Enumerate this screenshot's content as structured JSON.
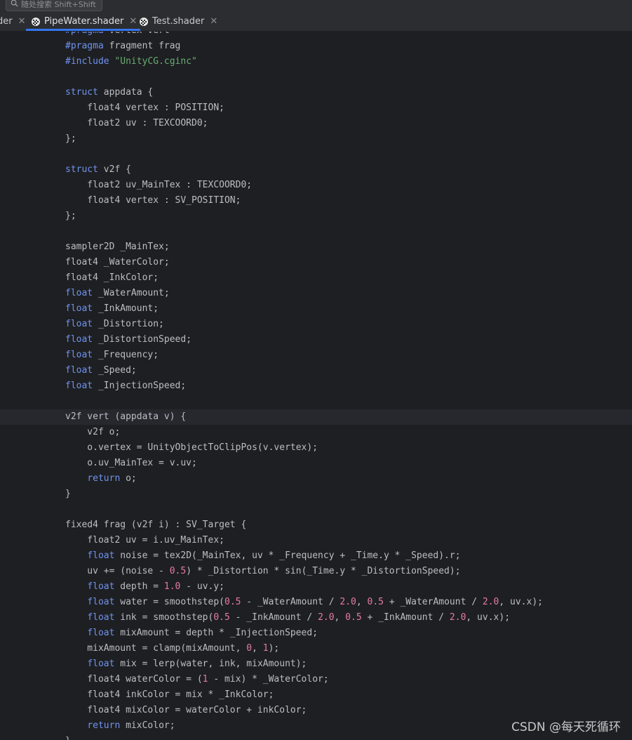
{
  "search": {
    "placeholder": "随处搜索 Shift+Shift"
  },
  "tabs": [
    {
      "label": "der",
      "active": false
    },
    {
      "label": "PipeWater.shader",
      "active": true
    },
    {
      "label": "Test.shader",
      "active": false
    }
  ],
  "code_lines": [
    "#pragma vertex vert",
    "#pragma fragment frag",
    "#include \"UnityCG.cginc\"",
    "",
    "struct appdata {",
    "    float4 vertex : POSITION;",
    "    float2 uv : TEXCOORD0;",
    "};",
    "",
    "struct v2f {",
    "    float2 uv_MainTex : TEXCOORD0;",
    "    float4 vertex : SV_POSITION;",
    "};",
    "",
    "sampler2D _MainTex;",
    "float4 _WaterColor;",
    "float4 _InkColor;",
    "float _WaterAmount;",
    "float _InkAmount;",
    "float _Distortion;",
    "float _DistortionSpeed;",
    "float _Frequency;",
    "float _Speed;",
    "float _InjectionSpeed;",
    "",
    "v2f vert (appdata v) {",
    "    v2f o;",
    "    o.vertex = UnityObjectToClipPos(v.vertex);",
    "    o.uv_MainTex = v.uv;",
    "    return o;",
    "}",
    "",
    "fixed4 frag (v2f i) : SV_Target {",
    "    float2 uv = i.uv_MainTex;",
    "    float noise = tex2D(_MainTex, uv * _Frequency + _Time.y * _Speed).r;",
    "    uv += (noise - 0.5) * _Distortion * sin(_Time.y * _DistortionSpeed);",
    "    float depth = 1.0 - uv.y;",
    "    float water = smoothstep(0.5 - _WaterAmount / 2.0, 0.5 + _WaterAmount / 2.0, uv.x);",
    "    float ink = smoothstep(0.5 - _InkAmount / 2.0, 0.5 + _InkAmount / 2.0, uv.x);",
    "    float mixAmount = depth * _InjectionSpeed;",
    "    mixAmount = clamp(mixAmount, 0, 1);",
    "    float mix = lerp(water, ink, mixAmount);",
    "    float4 waterColor = (1 - mix) * _WaterColor;",
    "    float4 inkColor = mix * _InkColor;",
    "    float4 mixColor = waterColor + inkColor;",
    "    return mixColor;",
    "}"
  ],
  "current_line_index": 25,
  "watermark": "CSDN @每天死循环",
  "colors": {
    "keyword": "#6f93f0",
    "string": "#6aab73",
    "number": "#e67ba0",
    "text": "#bcbec4",
    "accent": "#3574f0",
    "background": "#1e1f22"
  }
}
